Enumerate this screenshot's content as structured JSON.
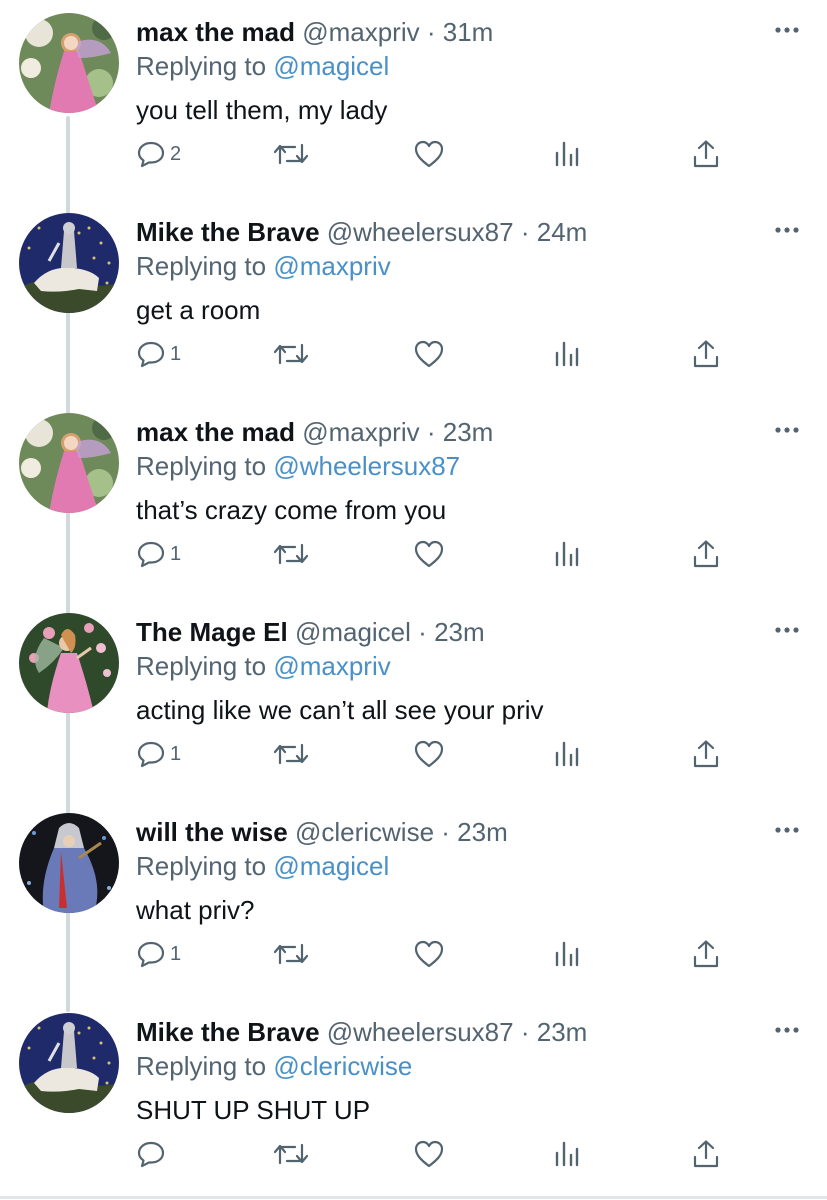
{
  "tweets": [
    {
      "name": "max the mad",
      "handle": "@maxpriv",
      "sep": "·",
      "time": "31m",
      "reply_prefix": "Replying to ",
      "reply_to": "@magicel",
      "text": "you tell them, my lady",
      "reply_count": "2",
      "avatar_icon": "fairy-pink-dress-avatar"
    },
    {
      "name": "Mike the Brave",
      "handle": "@wheelersux87",
      "sep": "·",
      "time": "24m",
      "reply_prefix": "Replying to ",
      "reply_to": "@maxpriv",
      "text": "get a room",
      "reply_count": "1",
      "avatar_icon": "knight-on-horse-avatar"
    },
    {
      "name": "max the mad",
      "handle": "@maxpriv",
      "sep": "·",
      "time": "23m",
      "reply_prefix": "Replying to ",
      "reply_to": "@wheelersux87",
      "text": "that’s crazy come from you",
      "reply_count": "1",
      "avatar_icon": "fairy-pink-dress-avatar"
    },
    {
      "name": "The Mage El",
      "handle": "@magicel",
      "sep": "·",
      "time": "23m",
      "reply_prefix": "Replying to ",
      "reply_to": "@maxpriv",
      "text": "acting like we can’t all see your priv",
      "reply_count": "1",
      "avatar_icon": "fairy-garden-avatar"
    },
    {
      "name": "will the wise",
      "handle": "@clericwise",
      "sep": "·",
      "time": "23m",
      "reply_prefix": "Replying to ",
      "reply_to": "@magicel",
      "text": "what priv?",
      "reply_count": "1",
      "avatar_icon": "wizard-robe-avatar"
    },
    {
      "name": "Mike the Brave",
      "handle": "@wheelersux87",
      "sep": "·",
      "time": "23m",
      "reply_prefix": "Replying to ",
      "reply_to": "@clericwise",
      "text": "SHUT UP SHUT UP",
      "reply_count": "",
      "avatar_icon": "knight-on-horse-avatar"
    }
  ],
  "colors": {
    "text": "#0f1419",
    "muted": "#536471",
    "link": "#4a90c8",
    "thread_line": "#cfd9de"
  },
  "icons": [
    "reply-icon",
    "retweet-icon",
    "like-icon",
    "views-icon",
    "share-icon",
    "more-options-icon"
  ]
}
